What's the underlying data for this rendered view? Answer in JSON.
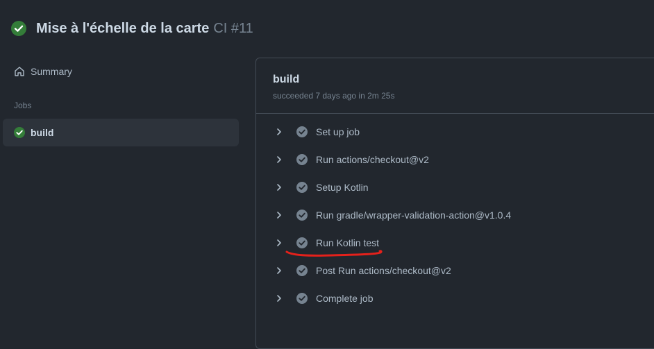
{
  "header": {
    "title": "Mise à l'échelle de la carte",
    "workflow": "CI #11",
    "status_icon": "check-circle-fill-icon",
    "status_color": "#347d39"
  },
  "sidebar": {
    "summary_label": "Summary",
    "jobs_heading": "Jobs",
    "jobs": [
      {
        "label": "build",
        "status_icon": "check-circle-fill-icon"
      }
    ]
  },
  "job": {
    "title": "build",
    "status": "succeeded 7 days ago in 2m 25s",
    "steps": [
      {
        "label": "Set up job"
      },
      {
        "label": "Run actions/checkout@v2"
      },
      {
        "label": "Setup Kotlin"
      },
      {
        "label": "Run gradle/wrapper-validation-action@v1.0.4"
      },
      {
        "label": "Run Kotlin test"
      },
      {
        "label": "Post Run actions/checkout@v2"
      },
      {
        "label": "Complete job"
      }
    ]
  },
  "annotation": {
    "color": "#e5211b",
    "target_step": "Run Kotlin test"
  },
  "colors": {
    "background": "#22272e",
    "border": "#444c56",
    "success": "#347d39",
    "step_icon": "#768390"
  }
}
